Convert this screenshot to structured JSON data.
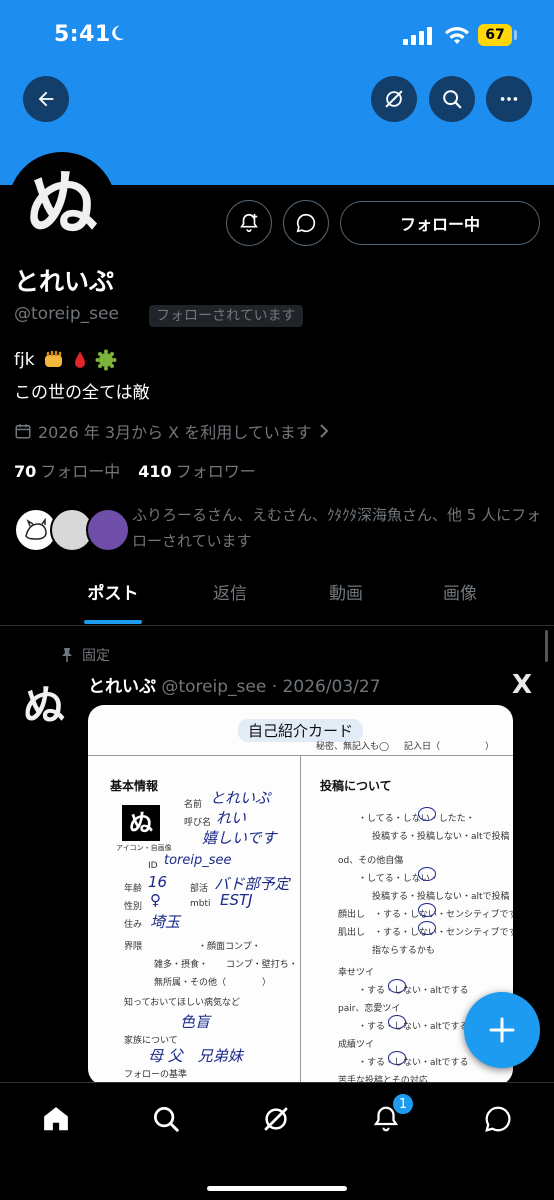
{
  "status_bar": {
    "time": "5:41",
    "battery": "67"
  },
  "profile": {
    "display_name": "とれいぷ",
    "handle": "@toreip_see",
    "follows_you": "フォローされています",
    "bio_line1": "fjk",
    "bio_line2": "この世の全ては敵",
    "joined": "2026 年 3月から X を利用しています",
    "following_count": "70",
    "following_label": "フォロー中",
    "followers_count": "410",
    "followers_label": "フォロワー",
    "mutuals_text": "ふりろーるさん、えむさん、ｸﾀｸﾀ深海魚さん、他 5 人にフォローされています",
    "avatar_glyph": "ぬ"
  },
  "actions": {
    "follow_label": "フォロー中"
  },
  "tabs": [
    {
      "label": "ポスト",
      "active": true
    },
    {
      "label": "返信",
      "active": false
    },
    {
      "label": "動画",
      "active": false
    },
    {
      "label": "画像",
      "active": false
    }
  ],
  "pinned_post": {
    "pinned_label": "固定",
    "author_name": "とれいぷ",
    "author_handle": "@toreip_see",
    "date": "· 2026/03/27",
    "x_logo": "X",
    "card": {
      "title": "自己紹介カード",
      "subtitle": "秘密、無記入も◯",
      "date_label": "記入日（　　　　　）",
      "section_basic": "基本情報",
      "section_posts": "投稿について",
      "name_label": "名前",
      "name_value": "とれいぷ",
      "callname_label": "呼び名",
      "callname_value": "れい",
      "callname_value2": "嬉しいです",
      "icon_caption": "アイコン・自画像",
      "id_label": "ID",
      "id_value": "toreip_see",
      "age_label": "年齢",
      "age_value": "16",
      "club_label": "部活",
      "club_value": "バド部予定",
      "gender_label": "性別",
      "gender_value": "♀",
      "mbti_label": "mbti",
      "mbti_value": "ESTJ",
      "live_label": "住み",
      "live_value": "埼玉",
      "realm_label": "界隈",
      "realm_line": "・顔面コンプ・",
      "realm_line2": "雑多・摂食・　　コンプ・壁打ち・",
      "realm_line3": "無所属・その他（　　　　）",
      "illness_label": "知っておいてほしい病気など",
      "illness_value": "色盲",
      "family_label": "家族について",
      "family_value": "母 父　兄弟妹",
      "follow_rule_label": "フォローの基準",
      "p1": "・してる・しない・したた・",
      "p1b": "投稿する・投稿しない・altで投稿",
      "p2": "od、その他自傷",
      "p2a": "・してる・しない・",
      "p2b": "投稿する・投稿しない・altで投稿",
      "p3": "顔出し　・する・しない・センシティブでする",
      "p4": "肌出し　・する・しない・センシティブでする",
      "p4b": "指ならするかも",
      "p5": "幸せツイ",
      "p5a": "・する・しない・altでする",
      "p6": "pair、恋愛ツイ",
      "p6a": "・する・しない・altでする",
      "p7": "成績ツイ",
      "p7a": "・する・しない・altでする",
      "p8": "苦手な投稿とその対応"
    }
  },
  "fab": {
    "icon": "plus-icon"
  },
  "bottom_nav": {
    "notif_count": "1"
  },
  "colors": {
    "accent": "#1d9bf0",
    "banner": "#1d8ef0",
    "muted": "#71767b"
  }
}
